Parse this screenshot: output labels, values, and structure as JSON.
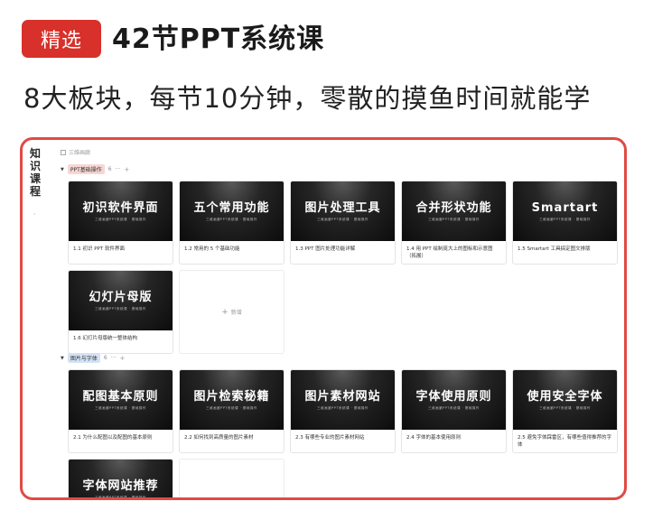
{
  "header": {
    "badge": "精选",
    "title": "42节PPT系统课",
    "subtitle": "8大板块，每节10分钟，零散的摸鱼时间就能学"
  },
  "panel": {
    "side_title": "知识课程",
    "view_label": "三维画廊",
    "groups": [
      {
        "tag": "PPT基础操作",
        "count": "6",
        "cards": [
          {
            "thumb": "初识软件界面",
            "caption": "1.1 初识 PPT 软件界面"
          },
          {
            "thumb": "五个常用功能",
            "caption": "1.2 常用的 5 个基础功能"
          },
          {
            "thumb": "图片处理工具",
            "caption": "1.3 PPT 图片处理功能详解"
          },
          {
            "thumb": "合并形状功能",
            "caption": "1.4 用 PPT 绘制庞大上的图标和示意图（拓展）"
          },
          {
            "thumb": "Smartart",
            "caption": "1.5 Smartart 工具搞定图文排版"
          },
          {
            "thumb": "幻灯片母版",
            "caption": "1.6 幻灯片母版统一整体结构"
          }
        ]
      },
      {
        "tag": "图片与字体",
        "count": "6",
        "cards": [
          {
            "thumb": "配图基本原则",
            "caption": "2.1 为什么配图以及配图的基本原则"
          },
          {
            "thumb": "图片检索秘籍",
            "caption": "2.2 如何找到高质量的图片素材"
          },
          {
            "thumb": "图片素材网站",
            "caption": "2.3 有哪些专业的图片素材网站"
          },
          {
            "thumb": "字体使用原则",
            "caption": "2.4 字体的基本使用原则"
          },
          {
            "thumb": "使用安全字体",
            "caption": "2.5 避免字体踩雷区，有哪些值得推荐的字体"
          },
          {
            "thumb": "字体网站推荐",
            "caption": ""
          }
        ]
      }
    ],
    "thumb_subtitle": "三维画廊PPT系统课 · 基础操作",
    "new_label": "新增",
    "plus": "+"
  }
}
